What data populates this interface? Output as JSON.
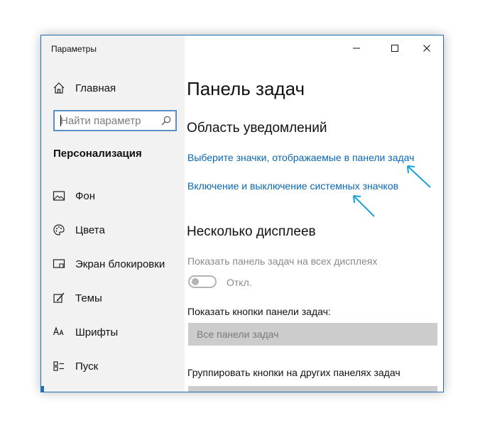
{
  "window": {
    "app_title": "Параметры",
    "controls": [
      "minimize",
      "maximize",
      "close"
    ]
  },
  "sidebar": {
    "home_label": "Главная",
    "search_placeholder": "Найти параметр",
    "section_label": "Персонализация",
    "items": [
      {
        "label": "Фон",
        "icon": "image-icon"
      },
      {
        "label": "Цвета",
        "icon": "palette-icon"
      },
      {
        "label": "Экран блокировки",
        "icon": "lock-screen-icon"
      },
      {
        "label": "Темы",
        "icon": "brush-icon"
      },
      {
        "label": "Шрифты",
        "icon": "font-icon"
      },
      {
        "label": "Пуск",
        "icon": "start-icon"
      }
    ]
  },
  "main": {
    "page_title": "Панель задач",
    "notifications_header": "Область уведомлений",
    "link_select_icons": "Выберите значки, отображаемые в панели задач",
    "link_system_icons": "Включение и выключение системных значков",
    "multi_display_header": "Несколько дисплеев",
    "show_taskbar_all_label": "Показать панель задач на всех дисплеях",
    "toggle_state": "Откл.",
    "show_buttons_label": "Показать кнопки панели задач:",
    "show_buttons_value": "Все панели задач",
    "group_buttons_label": "Группировать кнопки на других панелях задач"
  },
  "colors": {
    "accent": "#0a67b2",
    "annotation": "#1a9fd6",
    "sidebar_bg": "#f2f2f2",
    "select_bg": "#cccccc"
  }
}
